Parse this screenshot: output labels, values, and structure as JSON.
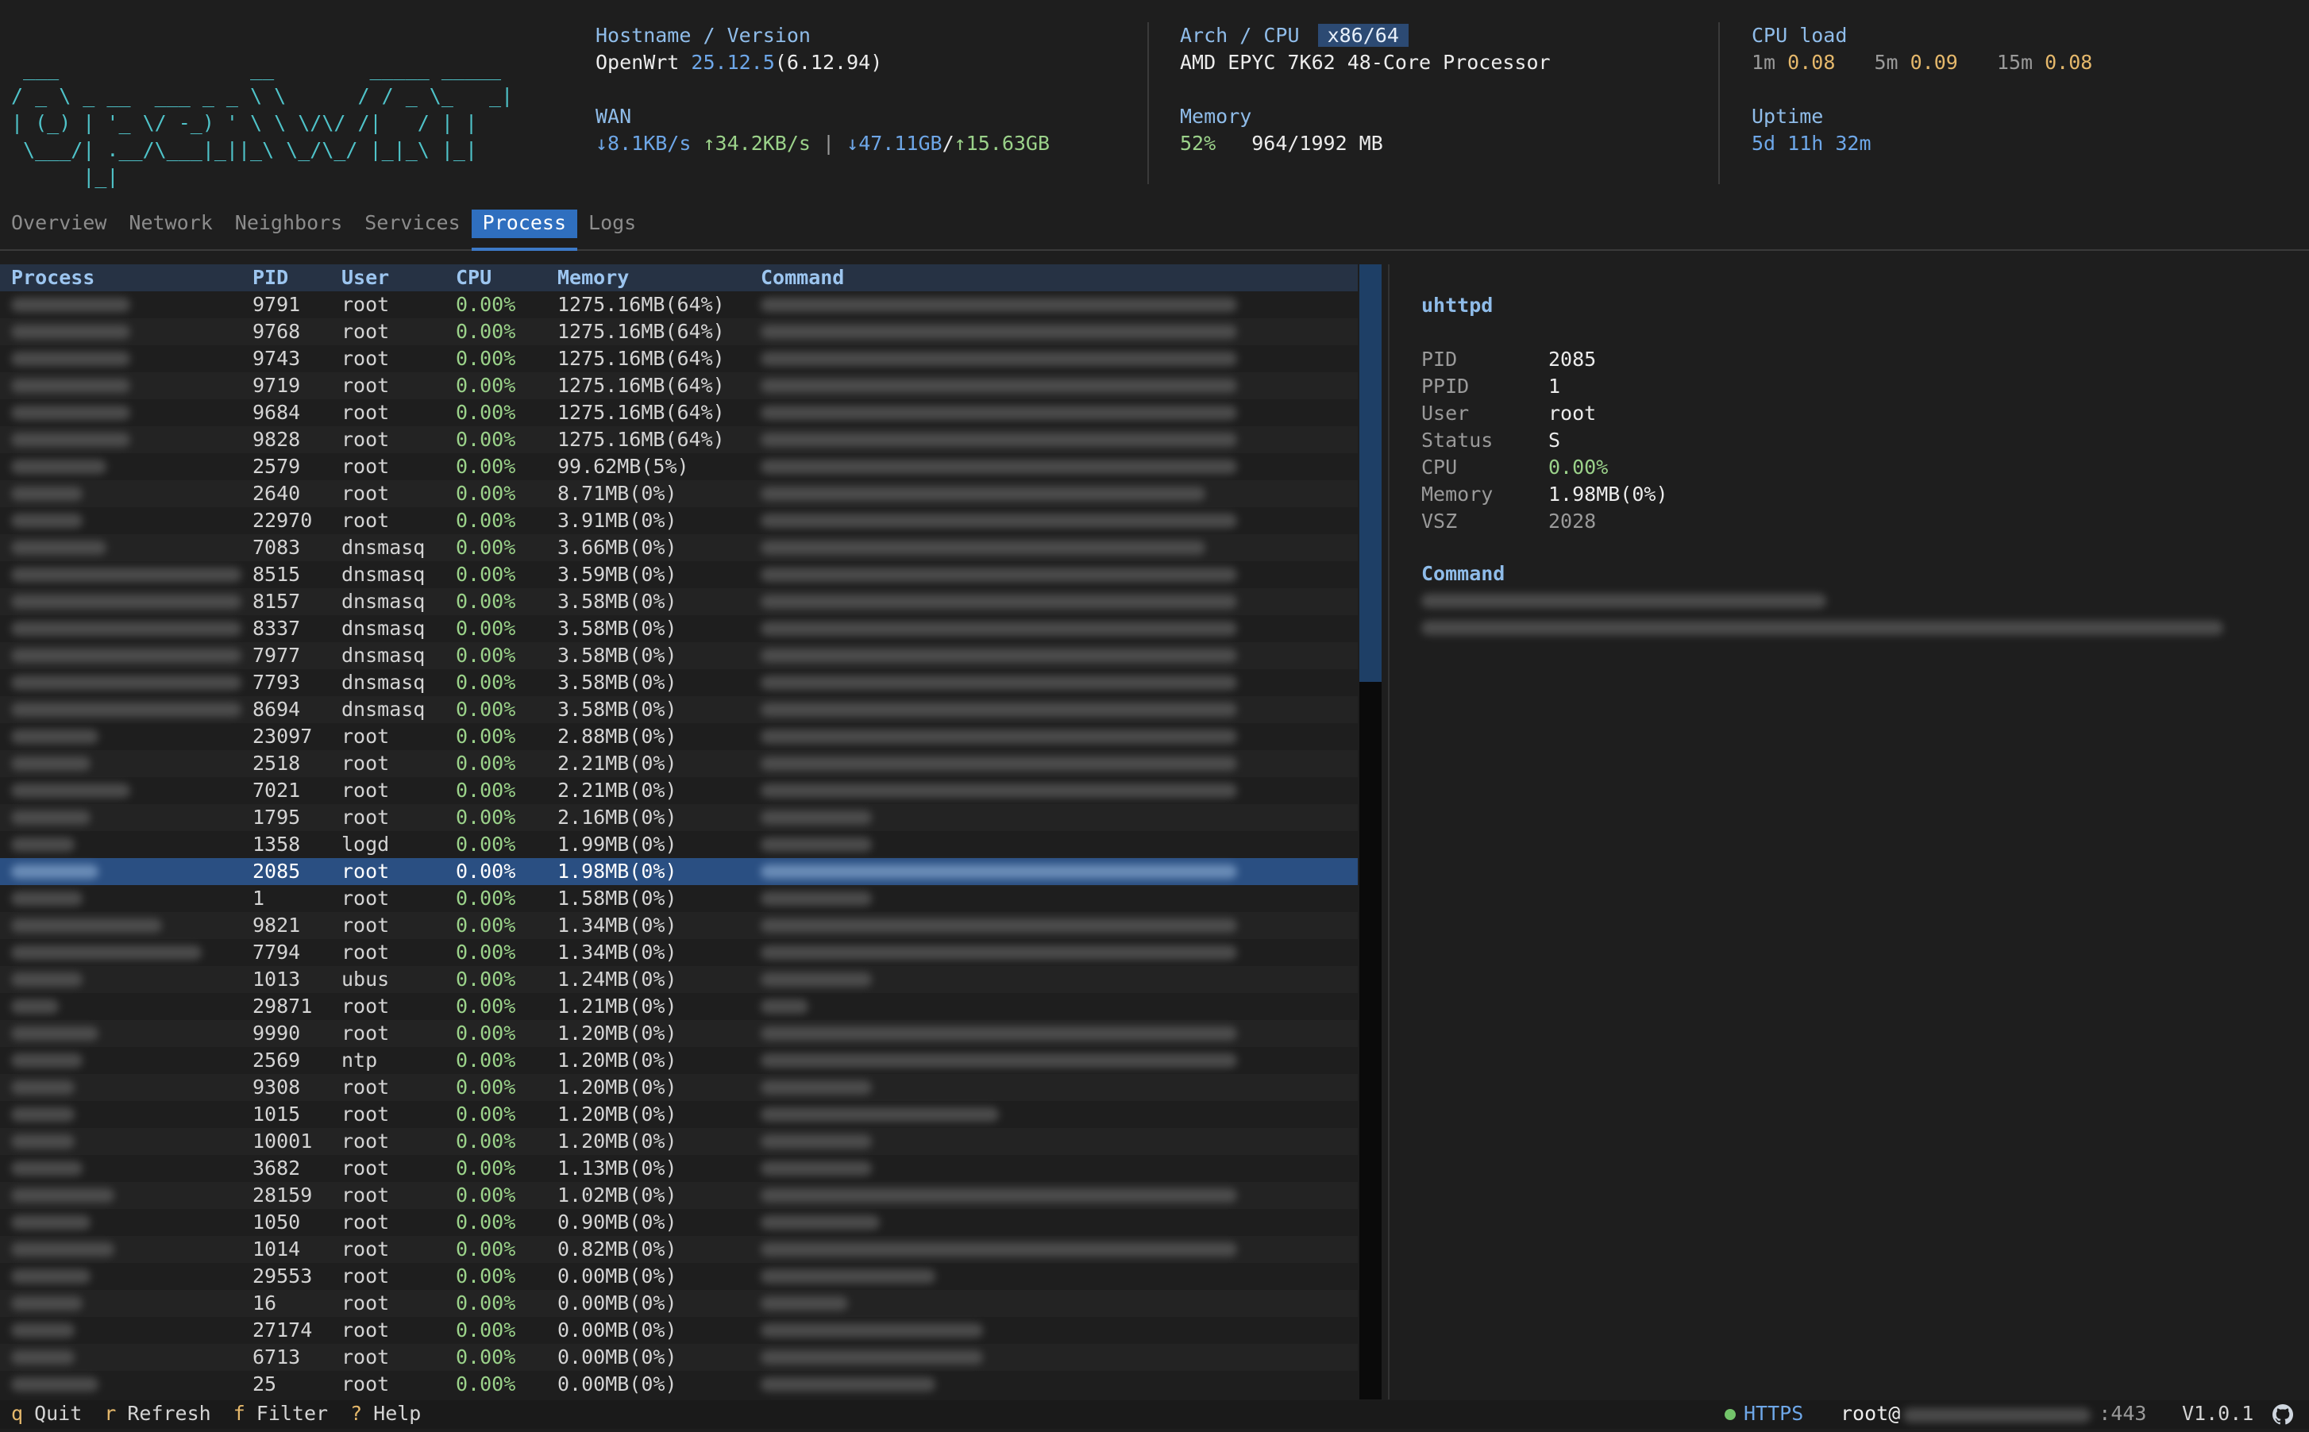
{
  "header": {
    "logo_ascii": [
      " ___                __        _____ _____",
      "/ _ \\ _ __  ___ _ _ \\ \\      / / _ \\_   _|",
      "| (_) | '_ \\/ -_) ' \\ \\ \\/\\/ /|   / | |",
      " \\___/| .__/\\___|_||_\\ \\_/\\_/ |_|_\\ |_|",
      "      |_|"
    ],
    "hostname_label": "Hostname / Version",
    "hostname": "OpenWrt",
    "version": "25.12.5",
    "kernel": "(6.12.94)",
    "wan_label": "WAN",
    "wan_down_rate": "↓8.1KB/s",
    "wan_up_rate": "↑34.2KB/s",
    "wan_sep": "|",
    "wan_down_total": "↓47.11GB",
    "wan_slash": "/",
    "wan_up_total": "↑15.63GB",
    "arch_label": "Arch / CPU",
    "arch_badge": "x86/64",
    "cpu_model": "AMD EPYC 7K62 48-Core Processor",
    "memory_label": "Memory",
    "memory_percent": "52%",
    "memory_used": "964/1992 MB",
    "cpuload_label": "CPU load",
    "load_1m_label": "1m",
    "load_1m": "0.08",
    "load_5m_label": "5m",
    "load_5m": "0.09",
    "load_15m_label": "15m",
    "load_15m": "0.08",
    "uptime_label": "Uptime",
    "uptime": "5d 11h 32m"
  },
  "tabs": [
    {
      "label": "Overview"
    },
    {
      "label": "Network"
    },
    {
      "label": "Neighbors"
    },
    {
      "label": "Services"
    },
    {
      "label": "Process",
      "active": true
    },
    {
      "label": "Logs"
    }
  ],
  "table": {
    "columns": [
      "Process",
      "PID",
      "User",
      "CPU",
      "Memory",
      "Command"
    ],
    "rows": [
      {
        "pid": "9791",
        "user": "root",
        "cpu": "0.00%",
        "mem": "1275.16MB(64%)"
      },
      {
        "pid": "9768",
        "user": "root",
        "cpu": "0.00%",
        "mem": "1275.16MB(64%)"
      },
      {
        "pid": "9743",
        "user": "root",
        "cpu": "0.00%",
        "mem": "1275.16MB(64%)"
      },
      {
        "pid": "9719",
        "user": "root",
        "cpu": "0.00%",
        "mem": "1275.16MB(64%)"
      },
      {
        "pid": "9684",
        "user": "root",
        "cpu": "0.00%",
        "mem": "1275.16MB(64%)"
      },
      {
        "pid": "9828",
        "user": "root",
        "cpu": "0.00%",
        "mem": "1275.16MB(64%)"
      },
      {
        "pid": "2579",
        "user": "root",
        "cpu": "0.00%",
        "mem": "99.62MB(5%)"
      },
      {
        "pid": "2640",
        "user": "root",
        "cpu": "0.00%",
        "mem": "8.71MB(0%)"
      },
      {
        "pid": "22970",
        "user": "root",
        "cpu": "0.00%",
        "mem": "3.91MB(0%)"
      },
      {
        "pid": "7083",
        "user": "dnsmasq",
        "cpu": "0.00%",
        "mem": "3.66MB(0%)"
      },
      {
        "pid": "8515",
        "user": "dnsmasq",
        "cpu": "0.00%",
        "mem": "3.59MB(0%)"
      },
      {
        "pid": "8157",
        "user": "dnsmasq",
        "cpu": "0.00%",
        "mem": "3.58MB(0%)"
      },
      {
        "pid": "8337",
        "user": "dnsmasq",
        "cpu": "0.00%",
        "mem": "3.58MB(0%)"
      },
      {
        "pid": "7977",
        "user": "dnsmasq",
        "cpu": "0.00%",
        "mem": "3.58MB(0%)"
      },
      {
        "pid": "7793",
        "user": "dnsmasq",
        "cpu": "0.00%",
        "mem": "3.58MB(0%)"
      },
      {
        "pid": "8694",
        "user": "dnsmasq",
        "cpu": "0.00%",
        "mem": "3.58MB(0%)"
      },
      {
        "pid": "23097",
        "user": "root",
        "cpu": "0.00%",
        "mem": "2.88MB(0%)"
      },
      {
        "pid": "2518",
        "user": "root",
        "cpu": "0.00%",
        "mem": "2.21MB(0%)"
      },
      {
        "pid": "7021",
        "user": "root",
        "cpu": "0.00%",
        "mem": "2.21MB(0%)"
      },
      {
        "pid": "1795",
        "user": "root",
        "cpu": "0.00%",
        "mem": "2.16MB(0%)"
      },
      {
        "pid": "1358",
        "user": "logd",
        "cpu": "0.00%",
        "mem": "1.99MB(0%)"
      },
      {
        "pid": "2085",
        "user": "root",
        "cpu": "0.00%",
        "mem": "1.98MB(0%)",
        "selected": true
      },
      {
        "pid": "1",
        "user": "root",
        "cpu": "0.00%",
        "mem": "1.58MB(0%)"
      },
      {
        "pid": "9821",
        "user": "root",
        "cpu": "0.00%",
        "mem": "1.34MB(0%)"
      },
      {
        "pid": "7794",
        "user": "root",
        "cpu": "0.00%",
        "mem": "1.34MB(0%)"
      },
      {
        "pid": "1013",
        "user": "ubus",
        "cpu": "0.00%",
        "mem": "1.24MB(0%)"
      },
      {
        "pid": "29871",
        "user": "root",
        "cpu": "0.00%",
        "mem": "1.21MB(0%)"
      },
      {
        "pid": "9990",
        "user": "root",
        "cpu": "0.00%",
        "mem": "1.20MB(0%)"
      },
      {
        "pid": "2569",
        "user": "ntp",
        "cpu": "0.00%",
        "mem": "1.20MB(0%)"
      },
      {
        "pid": "9308",
        "user": "root",
        "cpu": "0.00%",
        "mem": "1.20MB(0%)"
      },
      {
        "pid": "1015",
        "user": "root",
        "cpu": "0.00%",
        "mem": "1.20MB(0%)"
      },
      {
        "pid": "10001",
        "user": "root",
        "cpu": "0.00%",
        "mem": "1.20MB(0%)"
      },
      {
        "pid": "3682",
        "user": "root",
        "cpu": "0.00%",
        "mem": "1.13MB(0%)"
      },
      {
        "pid": "28159",
        "user": "root",
        "cpu": "0.00%",
        "mem": "1.02MB(0%)"
      },
      {
        "pid": "1050",
        "user": "root",
        "cpu": "0.00%",
        "mem": "0.90MB(0%)"
      },
      {
        "pid": "1014",
        "user": "root",
        "cpu": "0.00%",
        "mem": "0.82MB(0%)"
      },
      {
        "pid": "29553",
        "user": "root",
        "cpu": "0.00%",
        "mem": "0.00MB(0%)"
      },
      {
        "pid": "16",
        "user": "root",
        "cpu": "0.00%",
        "mem": "0.00MB(0%)"
      },
      {
        "pid": "27174",
        "user": "root",
        "cpu": "0.00%",
        "mem": "0.00MB(0%)"
      },
      {
        "pid": "6713",
        "user": "root",
        "cpu": "0.00%",
        "mem": "0.00MB(0%)"
      },
      {
        "pid": "25",
        "user": "root",
        "cpu": "0.00%",
        "mem": "0.00MB(0%)"
      }
    ]
  },
  "details": {
    "name": "uhttpd",
    "fields": [
      {
        "key": "PID",
        "value": "2085"
      },
      {
        "key": "PPID",
        "value": "1"
      },
      {
        "key": "User",
        "value": "root"
      },
      {
        "key": "Status",
        "value": "S"
      },
      {
        "key": "CPU",
        "value": "0.00%"
      },
      {
        "key": "Memory",
        "value": "1.98MB(0%)"
      },
      {
        "key": "VSZ",
        "value": "2028"
      }
    ],
    "command_label": "Command"
  },
  "footer": {
    "shortcuts": [
      {
        "key": "q",
        "label": "Quit"
      },
      {
        "key": "r",
        "label": "Refresh"
      },
      {
        "key": "f",
        "label": "Filter"
      },
      {
        "key": "?",
        "label": "Help"
      }
    ],
    "connection": "HTTPS",
    "login_user": "root@",
    "port": ":443",
    "version": "V1.0.1"
  }
}
